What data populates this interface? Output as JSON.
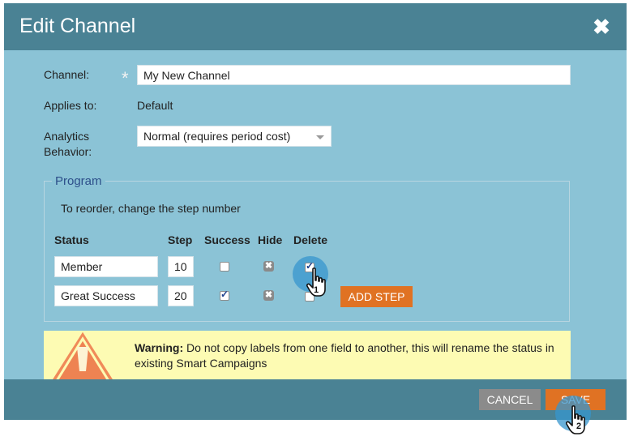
{
  "dialog": {
    "title": "Edit Channel",
    "close_glyph": "✖",
    "channel_label": "Channel:",
    "required_marker": "*",
    "channel_value": "My New Channel",
    "applies_label": "Applies to:",
    "applies_value": "Default",
    "analytics_label_line1": "Analytics",
    "analytics_label_line2": "Behavior:",
    "analytics_value": "Normal (requires period cost)"
  },
  "program": {
    "legend": "Program",
    "instruction": "To reorder, change the step number",
    "headers": {
      "status": "Status",
      "step": "Step",
      "success": "Success",
      "hide": "Hide",
      "delete": "Delete"
    },
    "rows": [
      {
        "status": "Member",
        "step": "10",
        "success": false,
        "delete": true
      },
      {
        "status": "Great Success",
        "step": "20",
        "success": true,
        "delete": false
      }
    ],
    "hide_glyph": "✖",
    "add_step_label": "ADD STEP"
  },
  "warning": {
    "bold": "Warning:",
    "text": " Do not copy labels from one field to another, this will rename the status in existing Smart Campaigns"
  },
  "footer": {
    "cancel_label": "CANCEL",
    "save_label": "SAVE"
  },
  "annotations": {
    "step1": "1",
    "step2": "2"
  },
  "colors": {
    "titlebar": "#4a8294",
    "body": "#8bc3d6",
    "accent": "#e07223",
    "cancel": "#8b8b8b",
    "warning_bg": "#fdfbb3"
  }
}
